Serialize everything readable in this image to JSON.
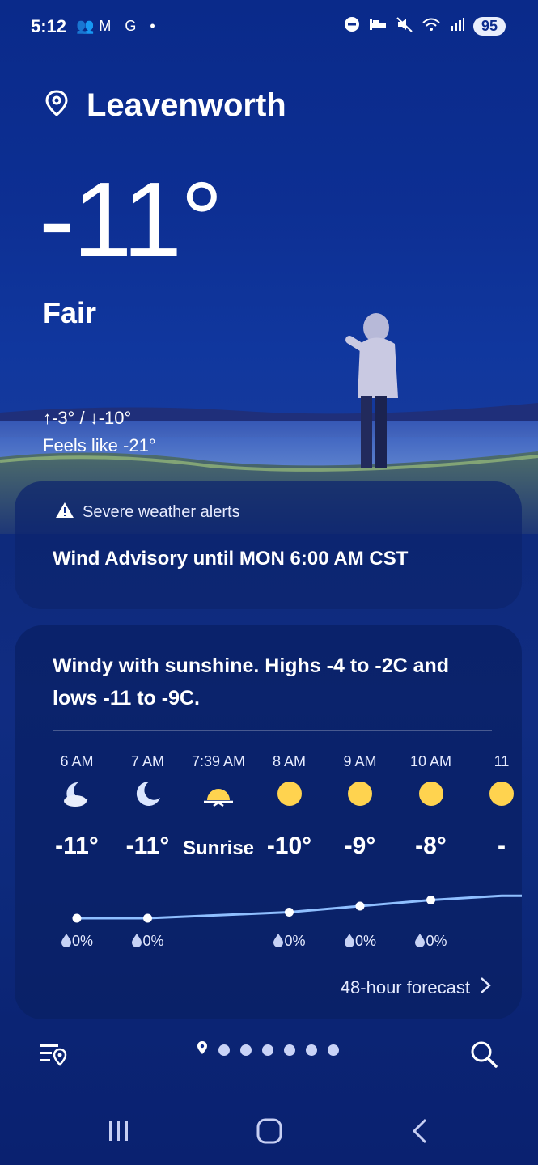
{
  "status_bar": {
    "time": "5:12",
    "left_icons": "👥M G •",
    "battery": "95"
  },
  "location": {
    "name": "Leavenworth"
  },
  "current": {
    "temperature": "-11°",
    "condition": "Fair",
    "high_low": "↑-3° / ↓-10°",
    "feels_like": "Feels like -21°"
  },
  "alerts": {
    "title": "Severe weather alerts",
    "message": "Wind Advisory until MON 6:00 AM CST"
  },
  "forecast": {
    "summary": "Windy with sunshine. Highs -4 to -2C and lows -11 to -9C.",
    "hours": [
      {
        "time": "6 AM",
        "icon": "moon-cloud-icon",
        "temp": "-11°",
        "precip": "0%"
      },
      {
        "time": "7 AM",
        "icon": "moon-icon",
        "temp": "-11°",
        "precip": "0%"
      },
      {
        "time": "7:39 AM",
        "icon": "sunrise-icon",
        "temp": "Sunrise",
        "precip": ""
      },
      {
        "time": "8 AM",
        "icon": "sun-icon",
        "temp": "-10°",
        "precip": "0%"
      },
      {
        "time": "9 AM",
        "icon": "sun-icon",
        "temp": "-9°",
        "precip": "0%"
      },
      {
        "time": "10 AM",
        "icon": "sun-icon",
        "temp": "-8°",
        "precip": "0%"
      },
      {
        "time": "11",
        "icon": "sun-icon",
        "temp": "-",
        "precip": ""
      }
    ],
    "more_label": "48-hour forecast"
  },
  "pager": {
    "pages": 7,
    "current": 0
  },
  "colors": {
    "accent_line": "#8fbfff",
    "sun": "#ffd34f",
    "moon": "#dbe6ff"
  }
}
